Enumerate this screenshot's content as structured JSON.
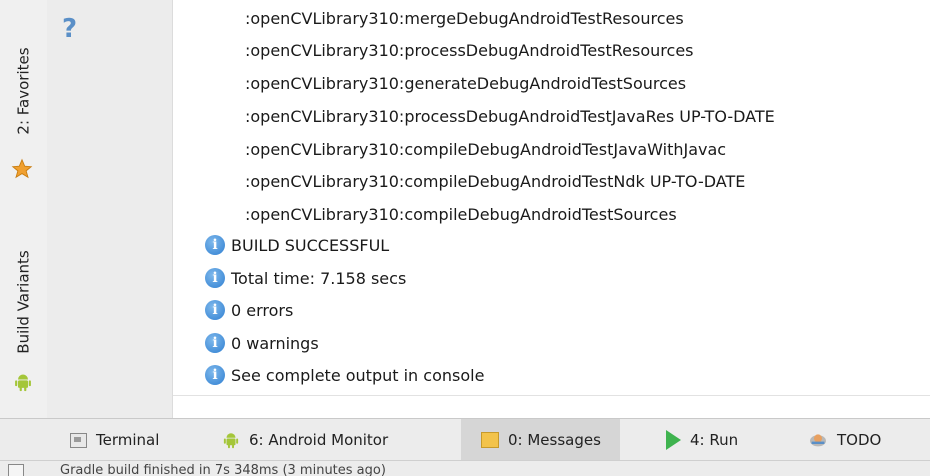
{
  "side_tabs": {
    "favorites": "2: Favorites",
    "build_variants": "Build Variants"
  },
  "gutter": {
    "help_glyph": "?"
  },
  "messages": {
    "tasks": [
      ":openCVLibrary310:mergeDebugAndroidTestResources",
      ":openCVLibrary310:processDebugAndroidTestResources",
      ":openCVLibrary310:generateDebugAndroidTestSources",
      ":openCVLibrary310:processDebugAndroidTestJavaRes UP-TO-DATE",
      ":openCVLibrary310:compileDebugAndroidTestJavaWithJavac",
      ":openCVLibrary310:compileDebugAndroidTestNdk UP-TO-DATE",
      ":openCVLibrary310:compileDebugAndroidTestSources"
    ],
    "info": [
      "BUILD SUCCESSFUL",
      "Total time: 7.158 secs",
      "0 errors",
      "0 warnings",
      "See complete output in console"
    ]
  },
  "bottom_tabs": {
    "terminal": {
      "label": "Terminal"
    },
    "android_monitor": {
      "label": "6: Android Monitor"
    },
    "messages": {
      "label": "0: Messages"
    },
    "run": {
      "label": "4: Run"
    },
    "todo": {
      "label": "TODO"
    }
  },
  "status_bar": {
    "text": "Gradle build finished in 7s 348ms (3 minutes ago)"
  },
  "colors": {
    "info_icon": "#2f7fd1",
    "android_green": "#a4c639",
    "run_green": "#3fb34f",
    "messages_icon": "#f3c34a",
    "favorites_star": "#f0a030"
  },
  "icons": [
    "help-icon",
    "star-icon",
    "android-icon",
    "info-icon",
    "terminal-icon",
    "messages-icon",
    "run-icon",
    "todo-icon"
  ]
}
